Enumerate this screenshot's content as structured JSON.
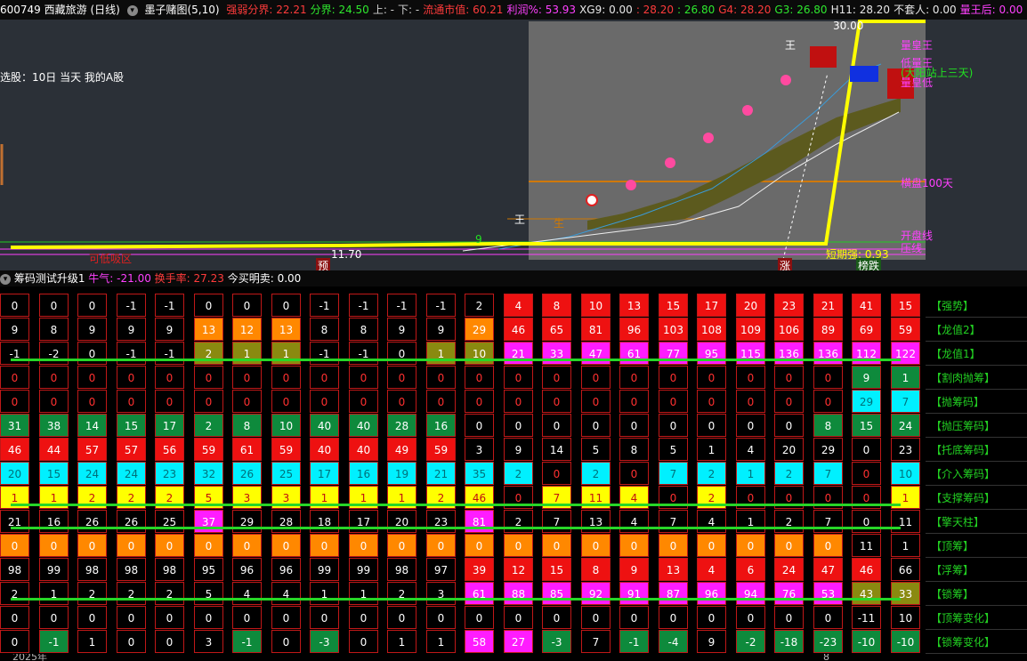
{
  "header": {
    "code_title": "600749 西藏旅游 (日线)",
    "indicator": "墨子赌图(5,10)",
    "items": [
      {
        "text": "强弱分界: 22.21",
        "color": "#ff3b3b"
      },
      {
        "text": "分界: 24.50",
        "color": "#2ee82e"
      },
      {
        "text": "上: -",
        "color": "#cfcfcf"
      },
      {
        "text": "下: -",
        "color": "#cfcfcf"
      },
      {
        "text": "流通市值: 60.21",
        "color": "#ff3b3b"
      },
      {
        "text": "利润%: 53.93",
        "color": "#ff40ff"
      },
      {
        "text": "XG9: 0.00",
        "color": "#e8e8e8"
      },
      {
        "text": ": 28.20",
        "color": "#ff3b3b"
      },
      {
        "text": ": 26.80",
        "color": "#2ee82e"
      },
      {
        "text": "G4: 28.20",
        "color": "#ff3b3b"
      },
      {
        "text": "G3: 26.80",
        "color": "#2ee82e"
      },
      {
        "text": "H11: 28.20",
        "color": "#e8e8e8"
      },
      {
        "text": "不套人: 0.00",
        "color": "#e8e8e8"
      },
      {
        "text": "量王后: 0.00",
        "color": "#ff40ff"
      },
      {
        "text": ": 30.00",
        "color": "#ff40ff"
      },
      {
        "text": "量王",
        "color": "#ff40ff"
      }
    ]
  },
  "chart": {
    "selection_text": "选股：10日 当天 我的A股",
    "price_top": "30.00",
    "price_low": "11.70",
    "labels": {
      "lianghuangwang": "量皇王",
      "didaotai": "低量王",
      "dayang": "(大阳站上三天)",
      "lianghuangdi": "量皇低",
      "pan100": "横盘100天",
      "jielao": "开盘线",
      "zhichen": "压线",
      "duanqi": "短期强: 0.93",
      "sheng": "生",
      "nine": "9",
      "yu": "预",
      "zhang": "涨",
      "bangdie": "榜跌",
      "wang1": "王",
      "wang2": "王",
      "bottom_red": "可低吸区"
    },
    "colors": {
      "accent": "#ffff00",
      "bg": "#2b3037"
    }
  },
  "sub": {
    "title": "筹码测试升级1",
    "niuqi": "牛气: -21.00",
    "huanshou": "换手率: 27.23",
    "jinmai": "今买明卖: 0.00"
  },
  "rows": [
    {
      "label": "【强势】",
      "values": [
        "0",
        "0",
        "0",
        "-1",
        "-1",
        "0",
        "0",
        "0",
        "-1",
        "-1",
        "-1",
        "-1",
        "2",
        "4",
        "8",
        "10",
        "13",
        "15",
        "17",
        "20",
        "23",
        "21",
        "41",
        "15"
      ],
      "colors": [
        "k",
        "k",
        "k",
        "k",
        "k",
        "k",
        "k",
        "k",
        "k",
        "k",
        "k",
        "k",
        "k",
        "r",
        "r",
        "r",
        "r",
        "r",
        "r",
        "r",
        "r",
        "r",
        "r",
        "r"
      ]
    },
    {
      "label": "【龙值2】",
      "values": [
        "9",
        "8",
        "9",
        "9",
        "9",
        "13",
        "12",
        "13",
        "8",
        "8",
        "9",
        "9",
        "29",
        "46",
        "65",
        "81",
        "96",
        "103",
        "108",
        "109",
        "106",
        "89",
        "69",
        "59"
      ],
      "colors": [
        "k",
        "k",
        "k",
        "k",
        "k",
        "o",
        "o",
        "o",
        "k",
        "k",
        "k",
        "k",
        "o",
        "r",
        "r",
        "r",
        "r",
        "r",
        "r",
        "r",
        "r",
        "r",
        "r",
        "r"
      ]
    },
    {
      "label": "【龙值1】",
      "values": [
        "-1",
        "-2",
        "0",
        "-1",
        "-1",
        "2",
        "1",
        "1",
        "-1",
        "-1",
        "0",
        "1",
        "10",
        "21",
        "33",
        "47",
        "61",
        "77",
        "95",
        "115",
        "136",
        "136",
        "112",
        "122"
      ],
      "colors": [
        "k",
        "k",
        "k",
        "k",
        "k",
        "v",
        "v",
        "v",
        "k",
        "k",
        "k",
        "v",
        "v",
        "m",
        "m",
        "m",
        "m",
        "m",
        "m",
        "m",
        "m",
        "m",
        "m",
        "m"
      ]
    },
    {
      "label": "【割肉抛筹】",
      "values": [
        "0",
        "0",
        "0",
        "0",
        "0",
        "0",
        "0",
        "0",
        "0",
        "0",
        "0",
        "0",
        "0",
        "0",
        "0",
        "0",
        "0",
        "0",
        "0",
        "0",
        "0",
        "0",
        "9",
        "1"
      ],
      "colors": [
        "kr",
        "kr",
        "kr",
        "kr",
        "kr",
        "kr",
        "kr",
        "kr",
        "kr",
        "kr",
        "kr",
        "kr",
        "kr",
        "kr",
        "kr",
        "kr",
        "kr",
        "kr",
        "kr",
        "kr",
        "kr",
        "kr",
        "g",
        "g"
      ]
    },
    {
      "label": "【抛筹码】",
      "values": [
        "0",
        "0",
        "0",
        "0",
        "0",
        "0",
        "0",
        "0",
        "0",
        "0",
        "0",
        "0",
        "0",
        "0",
        "0",
        "0",
        "0",
        "0",
        "0",
        "0",
        "0",
        "0",
        "29",
        "7"
      ],
      "colors": [
        "kr",
        "kr",
        "kr",
        "kr",
        "kr",
        "kr",
        "kr",
        "kr",
        "kr",
        "kr",
        "kr",
        "kr",
        "kr",
        "kr",
        "kr",
        "kr",
        "kr",
        "kr",
        "kr",
        "kr",
        "kr",
        "kr",
        "c",
        "c"
      ]
    },
    {
      "label": "【抛压筹码】",
      "values": [
        "31",
        "38",
        "14",
        "15",
        "17",
        "2",
        "8",
        "10",
        "40",
        "40",
        "28",
        "16",
        "0",
        "0",
        "0",
        "0",
        "0",
        "0",
        "0",
        "0",
        "0",
        "8",
        "15",
        "24"
      ],
      "colors": [
        "g",
        "g",
        "g",
        "g",
        "g",
        "g",
        "g",
        "g",
        "g",
        "g",
        "g",
        "g",
        "k",
        "k",
        "k",
        "k",
        "k",
        "k",
        "k",
        "k",
        "k",
        "g",
        "g",
        "g"
      ]
    },
    {
      "label": "【托底筹码】",
      "values": [
        "46",
        "44",
        "57",
        "57",
        "56",
        "59",
        "61",
        "59",
        "40",
        "40",
        "49",
        "59",
        "3",
        "9",
        "14",
        "5",
        "8",
        "5",
        "1",
        "4",
        "20",
        "29",
        "0",
        "23"
      ],
      "colors": [
        "r",
        "r",
        "r",
        "r",
        "r",
        "r",
        "r",
        "r",
        "r",
        "r",
        "r",
        "r",
        "k",
        "k",
        "k",
        "k",
        "k",
        "k",
        "k",
        "k",
        "k",
        "k",
        "k",
        "k"
      ]
    },
    {
      "label": "【介入筹码】",
      "values": [
        "20",
        "15",
        "24",
        "24",
        "23",
        "32",
        "26",
        "25",
        "17",
        "16",
        "19",
        "21",
        "35",
        "2",
        "0",
        "2",
        "0",
        "7",
        "2",
        "1",
        "2",
        "7",
        "0",
        "10"
      ],
      "colors": [
        "c",
        "c",
        "c",
        "c",
        "c",
        "c",
        "c",
        "c",
        "c",
        "c",
        "c",
        "c",
        "c",
        "c",
        "kr",
        "c",
        "kr",
        "c",
        "c",
        "c",
        "c",
        "c",
        "kr",
        "c"
      ]
    },
    {
      "label": "【支撑筹码】",
      "values": [
        "1",
        "1",
        "2",
        "2",
        "2",
        "5",
        "3",
        "3",
        "1",
        "1",
        "1",
        "2",
        "46",
        "0",
        "7",
        "11",
        "4",
        "0",
        "2",
        "0",
        "0",
        "0",
        "0",
        "1"
      ],
      "colors": [
        "y",
        "y",
        "y",
        "y",
        "y",
        "y",
        "y",
        "y",
        "y",
        "y",
        "y",
        "y",
        "y",
        "kr",
        "y",
        "y",
        "y",
        "kr",
        "y",
        "kr",
        "kr",
        "kr",
        "kr",
        "y"
      ]
    },
    {
      "label": "【擎天柱】",
      "values": [
        "21",
        "16",
        "26",
        "26",
        "25",
        "37",
        "29",
        "28",
        "18",
        "17",
        "20",
        "23",
        "81",
        "2",
        "7",
        "13",
        "4",
        "7",
        "4",
        "1",
        "2",
        "7",
        "0",
        "11"
      ],
      "colors": [
        "k",
        "k",
        "k",
        "k",
        "k",
        "m",
        "k",
        "k",
        "k",
        "k",
        "k",
        "k",
        "m",
        "k",
        "k",
        "k",
        "k",
        "k",
        "k",
        "k",
        "k",
        "k",
        "k",
        "k"
      ]
    },
    {
      "label": "【顶筹】",
      "values": [
        "0",
        "0",
        "0",
        "0",
        "0",
        "0",
        "0",
        "0",
        "0",
        "0",
        "0",
        "0",
        "0",
        "0",
        "0",
        "0",
        "0",
        "0",
        "0",
        "0",
        "0",
        "0",
        "11",
        "1"
      ],
      "colors": [
        "o",
        "o",
        "o",
        "o",
        "o",
        "o",
        "o",
        "o",
        "o",
        "o",
        "o",
        "o",
        "o",
        "o",
        "o",
        "o",
        "o",
        "o",
        "o",
        "o",
        "o",
        "o",
        "k",
        "k"
      ]
    },
    {
      "label": "【浮筹】",
      "values": [
        "98",
        "99",
        "98",
        "98",
        "98",
        "95",
        "96",
        "96",
        "99",
        "99",
        "98",
        "97",
        "39",
        "12",
        "15",
        "8",
        "9",
        "13",
        "4",
        "6",
        "24",
        "47",
        "46",
        "66"
      ],
      "colors": [
        "k",
        "k",
        "k",
        "k",
        "k",
        "k",
        "k",
        "k",
        "k",
        "k",
        "k",
        "k",
        "r",
        "r",
        "r",
        "r",
        "r",
        "r",
        "r",
        "r",
        "r",
        "r",
        "r",
        "k"
      ]
    },
    {
      "label": "【锁筹】",
      "values": [
        "2",
        "1",
        "2",
        "2",
        "2",
        "5",
        "4",
        "4",
        "1",
        "1",
        "2",
        "3",
        "61",
        "88",
        "85",
        "92",
        "91",
        "87",
        "96",
        "94",
        "76",
        "53",
        "43",
        "33"
      ],
      "colors": [
        "k",
        "k",
        "k",
        "k",
        "k",
        "k",
        "k",
        "k",
        "k",
        "k",
        "k",
        "k",
        "m",
        "m",
        "m",
        "m",
        "m",
        "m",
        "m",
        "m",
        "m",
        "m",
        "v",
        "v"
      ]
    },
    {
      "label": "【顶筹变化】",
      "values": [
        "0",
        "0",
        "0",
        "0",
        "0",
        "0",
        "0",
        "0",
        "0",
        "0",
        "0",
        "0",
        "0",
        "0",
        "0",
        "0",
        "0",
        "0",
        "0",
        "0",
        "0",
        "0",
        "-11",
        "10"
      ],
      "colors": [
        "k",
        "k",
        "k",
        "k",
        "k",
        "k",
        "k",
        "k",
        "k",
        "k",
        "k",
        "k",
        "k",
        "k",
        "k",
        "k",
        "k",
        "k",
        "k",
        "k",
        "k",
        "k",
        "k",
        "k"
      ]
    },
    {
      "label": "【锁筹变化】",
      "values": [
        "0",
        "-1",
        "1",
        "0",
        "0",
        "3",
        "-1",
        "0",
        "-3",
        "0",
        "1",
        "1",
        "58",
        "27",
        "-3",
        "7",
        "-1",
        "-4",
        "9",
        "-2",
        "-18",
        "-23",
        "-10",
        "-10"
      ],
      "colors": [
        "k",
        "g",
        "k",
        "k",
        "k",
        "k",
        "g",
        "k",
        "g",
        "k",
        "k",
        "k",
        "m",
        "m",
        "g",
        "k",
        "g",
        "g",
        "k",
        "g",
        "g",
        "g",
        "g",
        "g"
      ]
    }
  ],
  "footer": {
    "year": "2025年",
    "mark": "8"
  }
}
